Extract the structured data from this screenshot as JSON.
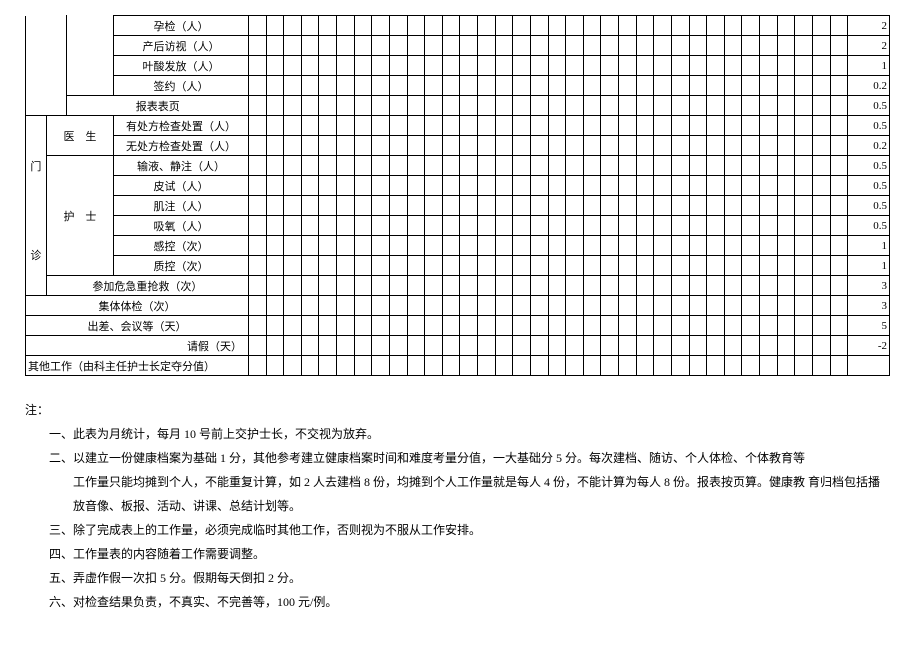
{
  "side": {
    "outpatient": "门",
    "clinic": "诊",
    "doctor": "医　生",
    "nurse": "护　士"
  },
  "rows": {
    "r1": {
      "label": "孕检（人）",
      "score": "2"
    },
    "r2": {
      "label": "产后访视（人）",
      "score": "2"
    },
    "r3": {
      "label": "叶酸发放（人）",
      "score": "1"
    },
    "r4": {
      "label": "签约（人）",
      "score": "0.2"
    },
    "r5": {
      "label": "报表表页",
      "score": "0.5"
    },
    "r6": {
      "label": "有处方检查处置（人）",
      "score": "0.5"
    },
    "r7": {
      "label": "无处方检查处置（人）",
      "score": "0.2"
    },
    "r8": {
      "label": "输液、静注（人）",
      "score": "0.5"
    },
    "r9": {
      "label": "皮试（人）",
      "score": "0.5"
    },
    "r10": {
      "label": "肌注（人）",
      "score": "0.5"
    },
    "r11": {
      "label": "吸氧（人）",
      "score": "0.5"
    },
    "r12": {
      "label": "感控（次）",
      "score": "1"
    },
    "r13": {
      "label": "质控（次）",
      "score": "1"
    },
    "r14": {
      "label": "参加危急重抢救（次）",
      "score": "3"
    },
    "r15": {
      "label": "集体体检（次）",
      "score": "3"
    },
    "r16": {
      "label": "出差、会议等（天）",
      "score": "5"
    },
    "r17": {
      "label": "请假（天）",
      "score": "-2"
    },
    "r18": {
      "label": "其他工作（由科主任护士长定夺分值）",
      "score": ""
    }
  },
  "notes": {
    "head": "注：",
    "n1": "一、此表为月统计，每月 10 号前上交护士长，不交视为放弃。",
    "n2a": "二、以建立一份健康档案为基础 1 分，其他参考建立健康档案时间和难度考量分值，一大基础分 5 分。每次建档、随访、个人体检、个体教育等",
    "n2b": "工作量只能均摊到个人，不能重复计算，如 2 人去建档 8 份，均摊到个人工作量就是每人 4 份，不能计算为每人 8 份。报表按页算。健康教 育归档包括播",
    "n2c": "放音像、板报、活动、讲课、总结计划等。",
    "n3": "三、除了完成表上的工作量，必须完成临时其他工作，否则视为不服从工作安排。",
    "n4": "四、工作量表的内容随着工作需要调整。",
    "n5": "五、弄虚作假一次扣 5 分。假期每天倒扣 2 分。",
    "n6": "六、对检查结果负责，不真实、不完善等，100 元/例。"
  }
}
